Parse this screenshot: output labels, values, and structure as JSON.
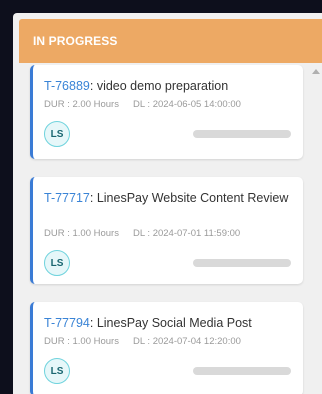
{
  "column": {
    "title": "IN PROGRESS"
  },
  "tasks": [
    {
      "id": "T-76889",
      "name": ": video demo preparation",
      "duration": "DUR : 2.00 Hours",
      "deadline": "DL : 2024-06-05 14:00:00",
      "assignee": "LS",
      "progress": 0
    },
    {
      "id": "T-77717",
      "name": ": LinesPay Website Content Review",
      "duration": "DUR : 1.00 Hours",
      "deadline": "DL : 2024-07-01 11:59:00",
      "assignee": "LS",
      "progress": 0
    },
    {
      "id": "T-77794",
      "name": ": LinesPay Social Media Post",
      "duration": "DUR : 1.00 Hours",
      "deadline": "DL : 2024-07-04 12:20:00",
      "assignee": "LS",
      "progress": 0
    }
  ],
  "colors": {
    "header": "#eda964",
    "accent": "#3a7bd5",
    "ticket_id": "#3a84d6",
    "avatar_border": "#6fd3dd"
  }
}
